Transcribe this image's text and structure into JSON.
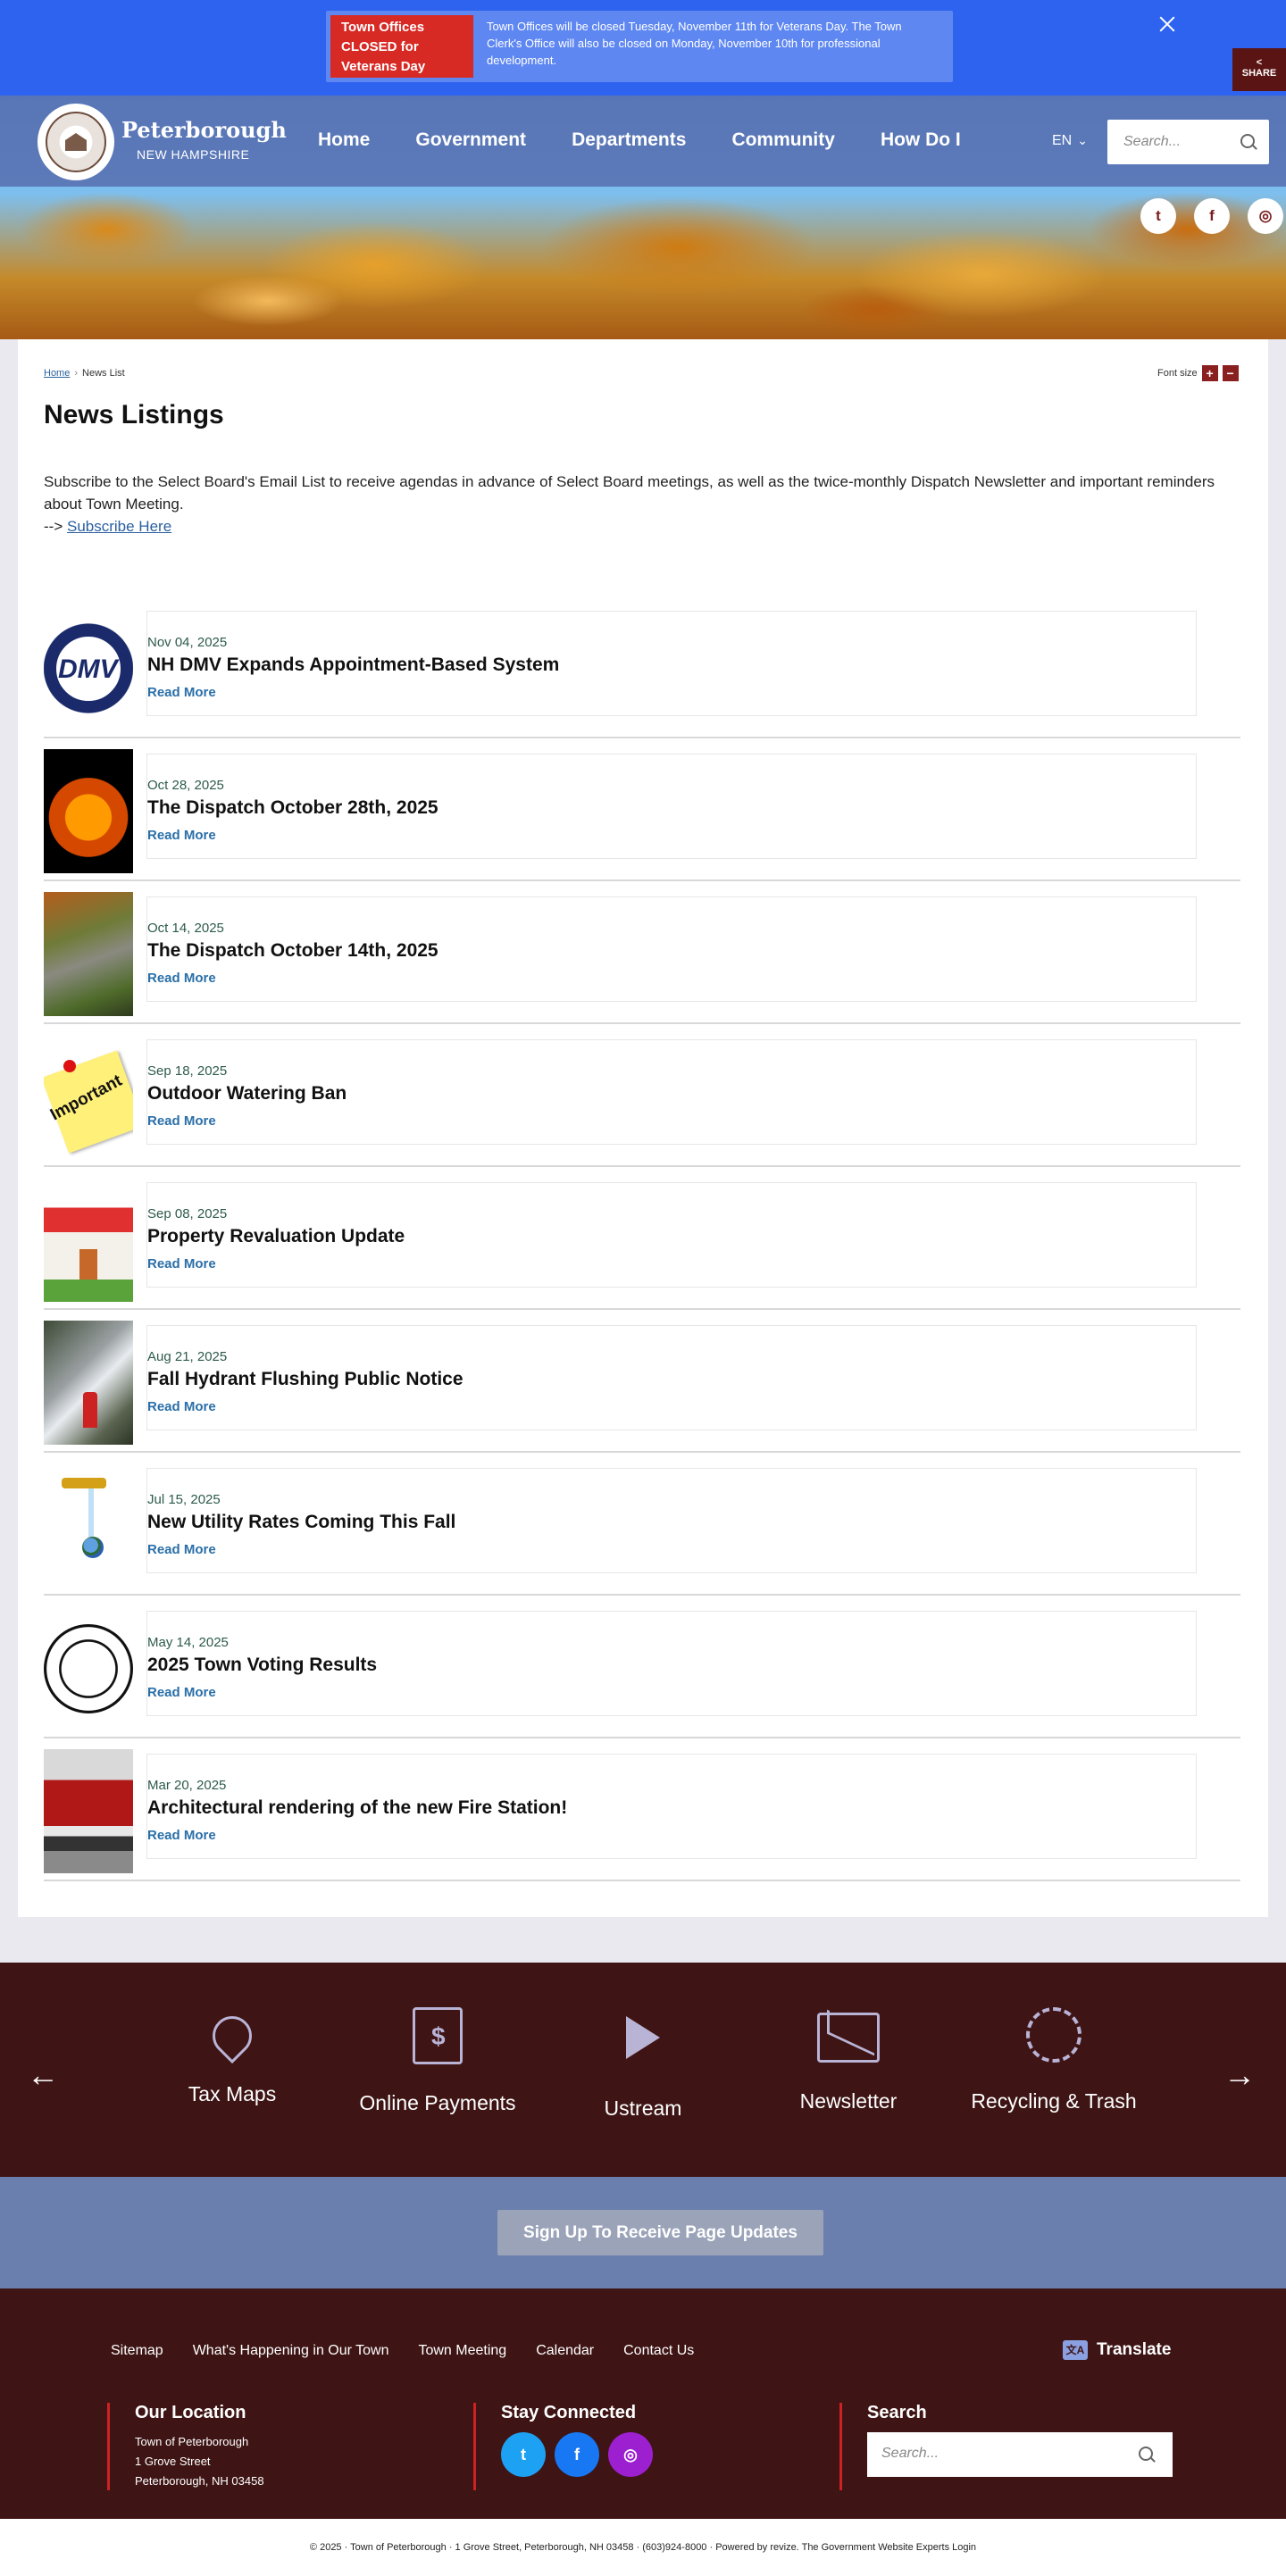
{
  "alert": {
    "title": "Town Offices CLOSED for Veterans Day",
    "text": "Town Offices will be closed Tuesday, November 11th for Veterans Day. The Town Clerk's Office will also be closed on Monday, November 10th for professional development."
  },
  "header": {
    "site_name": "Peterborough",
    "site_sub": "NEW HAMPSHIRE",
    "nav": [
      "Home",
      "Government",
      "Departments",
      "Community",
      "How Do I"
    ],
    "lang": "EN",
    "search_placeholder": "Search..."
  },
  "social": {
    "twitter": "t",
    "facebook": "f",
    "instagram": "◎"
  },
  "breadcrumb": {
    "home": "Home",
    "current": "News List"
  },
  "font_size_label": "Font size",
  "share_label": "SHARE",
  "page": {
    "title": "News Listings",
    "intro": "Subscribe to the Select Board's Email List to receive agendas in advance of Select Board meetings, as well as the twice-monthly Dispatch Newsletter and important reminders about Town Meeting.",
    "intro_prefix": "-->",
    "subscribe_link": "Subscribe Here"
  },
  "news": [
    {
      "date": "Nov 04, 2025",
      "title": "NH DMV Expands Appointment-Based System",
      "more": "Read More"
    },
    {
      "date": "Oct 28, 2025",
      "title": "The Dispatch October 28th, 2025",
      "more": "Read More"
    },
    {
      "date": "Oct 14, 2025",
      "title": "The Dispatch October 14th, 2025",
      "more": "Read More"
    },
    {
      "date": "Sep 18, 2025",
      "title": "Outdoor Watering Ban",
      "more": "Read More"
    },
    {
      "date": "Sep 08, 2025",
      "title": "Property Revaluation Update",
      "more": "Read More"
    },
    {
      "date": "Aug 21, 2025",
      "title": "Fall Hydrant Flushing Public Notice",
      "more": "Read More"
    },
    {
      "date": "Jul 15, 2025",
      "title": "New Utility Rates Coming This Fall",
      "more": "Read More"
    },
    {
      "date": "May 14, 2025",
      "title": "2025 Town Voting Results",
      "more": "Read More"
    },
    {
      "date": "Mar 20, 2025",
      "title": "Architectural rendering of the new Fire Station!",
      "more": "Read More"
    }
  ],
  "quicklinks": [
    "Tax Maps",
    "Online Payments",
    "Ustream",
    "Newsletter",
    "Recycling & Trash"
  ],
  "signup_label": "Sign Up To Receive Page Updates",
  "footer": {
    "links": [
      "Sitemap",
      "What's Happening in Our Town",
      "Town Meeting",
      "Calendar",
      "Contact Us"
    ],
    "translate": "Translate",
    "location_title": "Our Location",
    "location_lines": [
      "Town of Peterborough",
      "1 Grove Street",
      "Peterborough, NH 03458"
    ],
    "connected_title": "Stay Connected",
    "search_title": "Search",
    "search_placeholder": "Search..."
  },
  "copyright": "© 2025 · Town of Peterborough · 1 Grove Street, Peterborough, NH 03458 · (603)924-8000 · Powered by revize. The Government Website Experts Login",
  "colors": {
    "alert_bg": "#2e63f0",
    "alert_title_bg": "#d72a25",
    "footer_bg": "#3e1414",
    "signup_bg": "#6b7fae",
    "link": "#2a6fa8"
  }
}
